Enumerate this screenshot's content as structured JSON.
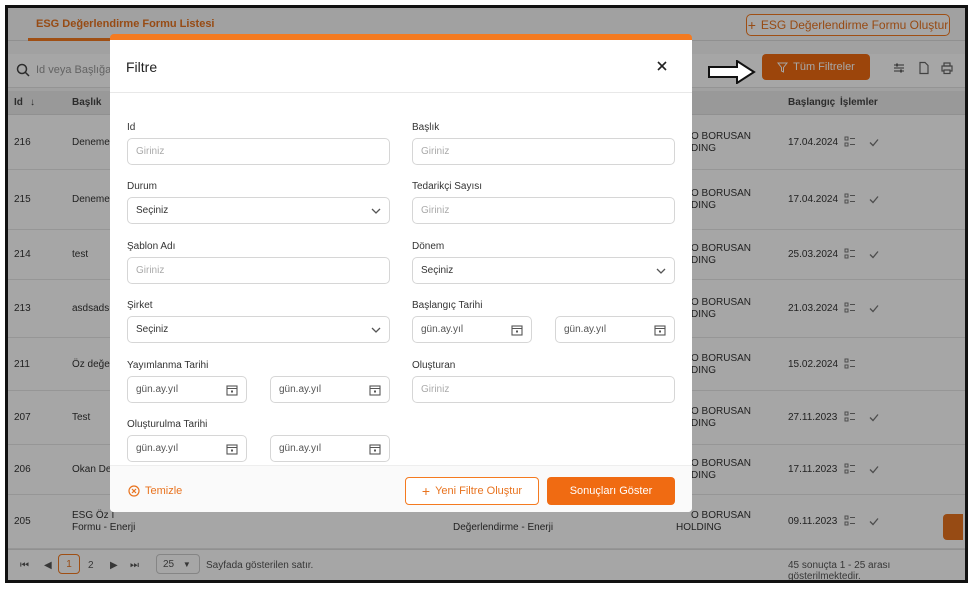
{
  "header": {
    "tab_title": "ESG Değerlendirme Formu Listesi",
    "create_button": "ESG Değerlendirme Formu Oluştur"
  },
  "toolbar": {
    "search_placeholder": "Id veya Başlığa",
    "filters_button": "Tüm Filtreler"
  },
  "table": {
    "columns": [
      "Id",
      "Başlık",
      "Başlangıç",
      "İşlemler"
    ],
    "company_partial_line1": "O BORUSAN",
    "company_partial_line2": "DING",
    "rows": [
      {
        "id": "216",
        "title": "Deneme",
        "date": "17.04.2024",
        "approved": true
      },
      {
        "id": "215",
        "title": "Deneme",
        "date": "17.04.2024",
        "approved": true
      },
      {
        "id": "214",
        "title": "test",
        "date": "25.03.2024",
        "approved": true
      },
      {
        "id": "213",
        "title": "asdsads",
        "date": "21.03.2024",
        "approved": true
      },
      {
        "id": "211",
        "title": "Öz değe",
        "date": "15.02.2024",
        "approved": false
      },
      {
        "id": "207",
        "title": "Test",
        "date": "27.11.2023",
        "approved": true
      },
      {
        "id": "206",
        "title": "Okan De",
        "date": "17.11.2023",
        "approved": true
      },
      {
        "id": "205",
        "title": "ESG Öz I",
        "title_line2": "Formu - Enerji",
        "date": "09.11.2023",
        "approved": true
      }
    ],
    "row205_template": "Değerlendirme - Enerji",
    "row205_company": "HOLDING"
  },
  "pager": {
    "pages": [
      "1",
      "2"
    ],
    "page_size": "25",
    "rows_label": "Sayfada gösterilen satır.",
    "summary": "45 sonuçta 1 - 25 arası gösterilmektedir."
  },
  "modal": {
    "title": "Filtre",
    "fields": {
      "id": {
        "label": "Id",
        "placeholder": "Giriniz"
      },
      "baslik": {
        "label": "Başlık",
        "placeholder": "Giriniz"
      },
      "durum": {
        "label": "Durum",
        "value": "Seçiniz"
      },
      "tedarikci": {
        "label": "Tedarikçi Sayısı",
        "placeholder": "Giriniz"
      },
      "sablon": {
        "label": "Şablon Adı",
        "placeholder": "Giriniz"
      },
      "donem": {
        "label": "Dönem",
        "value": "Seçiniz"
      },
      "sirket": {
        "label": "Şirket",
        "value": "Seçiniz"
      },
      "baslangic": {
        "label": "Başlangıç Tarihi",
        "from": "gün.ay.yıl",
        "to": "gün.ay.yıl"
      },
      "yayimlanma": {
        "label": "Yayımlanma Tarihi",
        "from": "gün.ay.yıl",
        "to": "gün.ay.yıl"
      },
      "olusturan": {
        "label": "Oluşturan",
        "placeholder": "Giriniz"
      },
      "olusturulma": {
        "label": "Oluşturulma Tarihi",
        "from": "gün.ay.yıl",
        "to": "gün.ay.yıl"
      }
    },
    "clear_label": "Temizle",
    "new_filter_label": "Yeni Filtre Oluştur",
    "show_results_label": "Sonuçları Göster"
  },
  "colors": {
    "accent": "#f06b12",
    "accent_text": "#e8731f"
  }
}
